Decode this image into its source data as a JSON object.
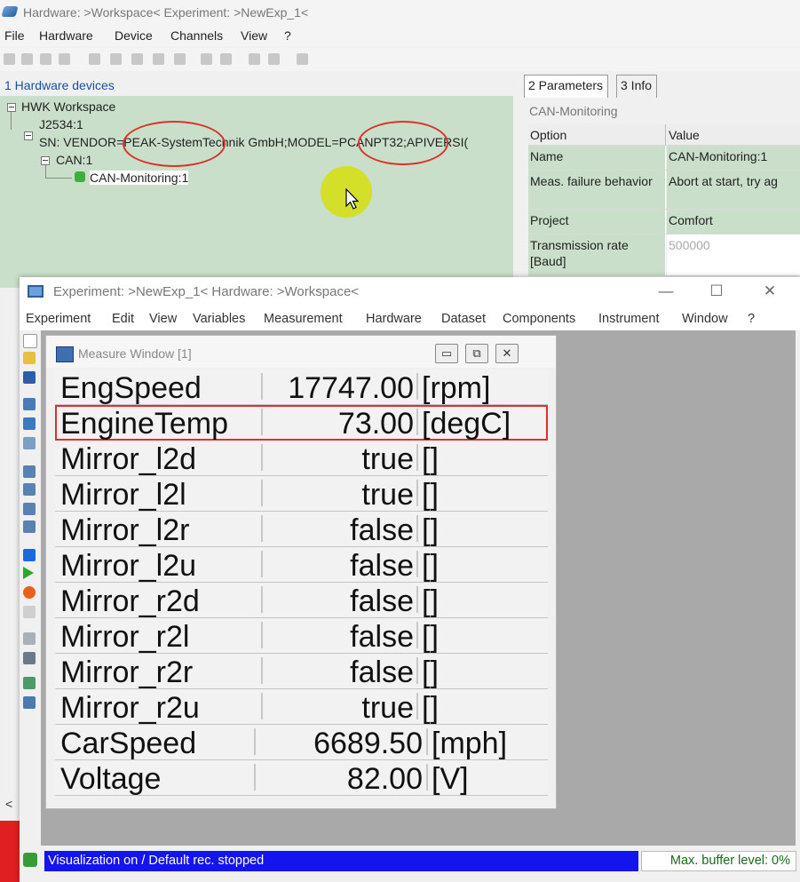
{
  "hw_window": {
    "title": "Hardware: >Workspace<  Experiment: >NewExp_1<",
    "menu": [
      "File",
      "Hardware",
      "Device",
      "Channels",
      "View",
      "?"
    ],
    "devices_header": "1 Hardware devices",
    "tree": {
      "workspace": "HWK Workspace",
      "j2534": "J2534:1",
      "sn": "SN: VENDOR=PEAK-SystemTechnik GmbH;MODEL=PCANPT32;APIVERSI(",
      "can": "CAN:1",
      "monitoring": "CAN-Monitoring:1"
    },
    "tabs": [
      "2 Parameters",
      "3 Info"
    ],
    "param_header": "CAN-Monitoring",
    "param_columns": [
      "Option",
      "Value"
    ],
    "params": [
      {
        "option": "Name",
        "value": "CAN-Monitoring:1"
      },
      {
        "option": "Meas. failure behavior",
        "value": "Abort at start, try ag"
      },
      {
        "option": "Project",
        "value": "Comfort"
      },
      {
        "option": "Transmission rate [Baud]",
        "value": "500000"
      }
    ]
  },
  "exp_window": {
    "title": "Experiment: >NewExp_1< Hardware: >Workspace<",
    "controls": {
      "minimize": "—",
      "maximize": "☐",
      "close": "✕"
    },
    "menu": [
      "Experiment",
      "Edit",
      "View",
      "Variables",
      "Measurement",
      "Hardware",
      "Dataset",
      "Components",
      "Instrument",
      "Window",
      "?"
    ],
    "measure_window": {
      "title": "Measure Window [1]",
      "buttons": {
        "minimize": "▭",
        "restore": "⧉",
        "close": "✕"
      },
      "rows": [
        {
          "name": "EngSpeed",
          "value": "17747.00",
          "unit": "[rpm]"
        },
        {
          "name": "EngineTemp",
          "value": "73.00",
          "unit": "[degC]"
        },
        {
          "name": "Mirror_l2d",
          "value": "true",
          "unit": "[]"
        },
        {
          "name": "Mirror_l2l",
          "value": "true",
          "unit": "[]"
        },
        {
          "name": "Mirror_l2r",
          "value": "false",
          "unit": "[]"
        },
        {
          "name": "Mirror_l2u",
          "value": "false",
          "unit": "[]"
        },
        {
          "name": "Mirror_r2d",
          "value": "false",
          "unit": "[]"
        },
        {
          "name": "Mirror_r2l",
          "value": "false",
          "unit": "[]"
        },
        {
          "name": "Mirror_r2r",
          "value": "false",
          "unit": "[]"
        },
        {
          "name": "Mirror_r2u",
          "value": "true",
          "unit": "[]"
        },
        {
          "name": "CarSpeed",
          "value": "6689.50",
          "unit": "[mph]"
        },
        {
          "name": "Voltage",
          "value": "82.00",
          "unit": "[V]"
        }
      ]
    },
    "status": {
      "left": "Visualization on / Default rec. stopped",
      "right": "Max. buffer level: 0%"
    }
  },
  "misc": {
    "scroll_left": "<"
  }
}
